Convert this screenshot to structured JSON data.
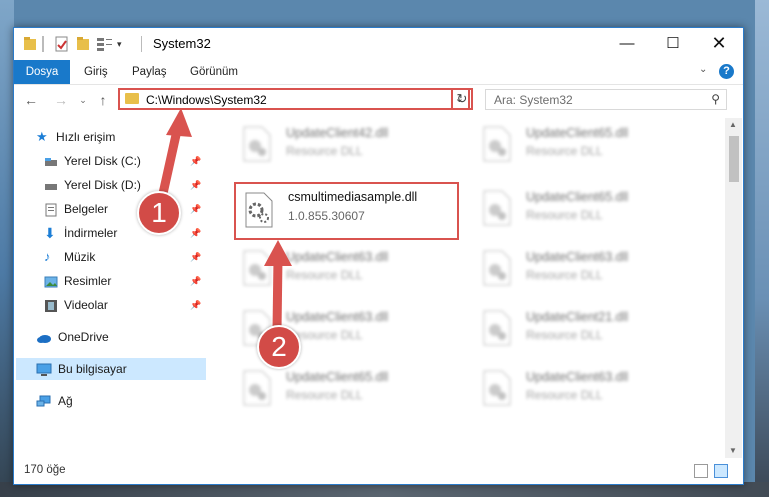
{
  "window": {
    "title": "System32"
  },
  "ribbon": {
    "tabs": [
      "Dosya",
      "Giriş",
      "Paylaş",
      "Görünüm"
    ]
  },
  "address": {
    "path": "C:\\Windows\\System32"
  },
  "search": {
    "placeholder": "Ara: System32"
  },
  "sidebar": {
    "items": [
      {
        "label": "Hızlı erişim"
      },
      {
        "label": "Yerel Disk (C:)"
      },
      {
        "label": "Yerel Disk (D:)"
      },
      {
        "label": "Belgeler"
      },
      {
        "label": "İndirmeler"
      },
      {
        "label": "Müzik"
      },
      {
        "label": "Resimler"
      },
      {
        "label": "Videolar"
      },
      {
        "label": "OneDrive"
      },
      {
        "label": "Bu bilgisayar"
      },
      {
        "label": "Ağ"
      }
    ]
  },
  "files": [
    {
      "name": "UpdateClient42.dll",
      "type": "Resource DLL"
    },
    {
      "name": "UpdateClient65.dll",
      "type": "Resource DLL"
    },
    {
      "name": "csmultimediasample.dll",
      "type": "1.0.855.30607"
    },
    {
      "name": "UpdateClient65.dll",
      "type": "Resource DLL"
    },
    {
      "name": "UpdateClient63.dll",
      "type": "Resource DLL"
    },
    {
      "name": "UpdateClient63.dll",
      "type": "Resource DLL"
    },
    {
      "name": "UpdateClient63.dll",
      "type": "Resource DLL"
    },
    {
      "name": "UpdateClient21.dll",
      "type": "Resource DLL"
    },
    {
      "name": "UpdateClient65.dll",
      "type": "Resource DLL"
    },
    {
      "name": "UpdateClient63.dll",
      "type": "Resource DLL"
    }
  ],
  "status": {
    "count": "170 öğe"
  },
  "callouts": {
    "one": "1",
    "two": "2"
  },
  "colors": {
    "accent": "#1979ca",
    "highlight": "#d9534f",
    "selection": "#cce8ff"
  }
}
